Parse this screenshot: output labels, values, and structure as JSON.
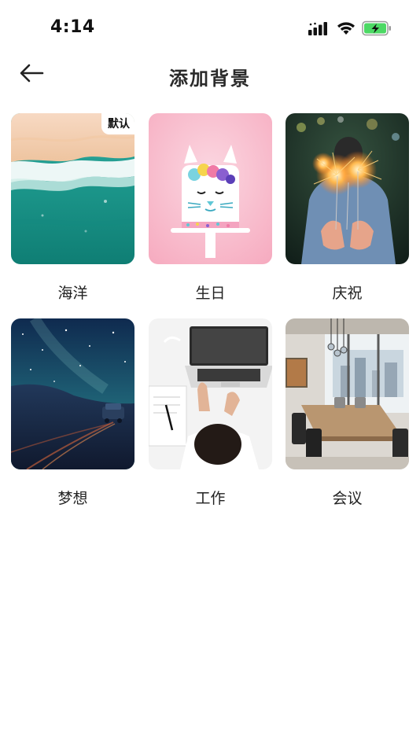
{
  "status_bar": {
    "time": "4:14",
    "icons": [
      "cellular-signal-icon",
      "wifi-icon",
      "battery-charging-icon"
    ],
    "battery_color": "#4cd964"
  },
  "nav": {
    "back_icon": "arrow-left-icon",
    "title": "添加背景"
  },
  "backgrounds": [
    {
      "label": "海洋",
      "badge": "默认",
      "is_default": true
    },
    {
      "label": "生日",
      "badge": "",
      "is_default": false
    },
    {
      "label": "庆祝",
      "badge": "",
      "is_default": false
    },
    {
      "label": "梦想",
      "badge": "",
      "is_default": false
    },
    {
      "label": "工作",
      "badge": "",
      "is_default": false
    },
    {
      "label": "会议",
      "badge": "",
      "is_default": false
    }
  ]
}
